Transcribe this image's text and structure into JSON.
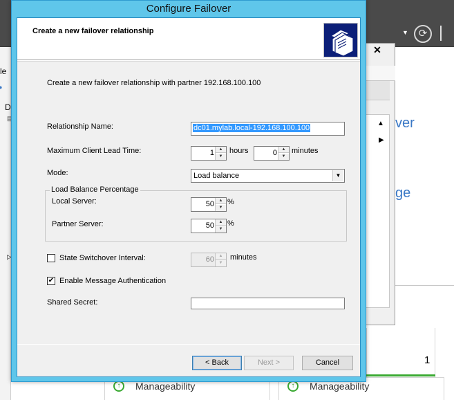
{
  "background": {
    "left_pane": [
      "le",
      "D"
    ],
    "links": [
      "ver",
      "ge"
    ],
    "card_value": "1",
    "status_items": [
      {
        "label": "Manageability"
      },
      {
        "label": "Manageability"
      }
    ]
  },
  "dialog": {
    "title": "Configure Failover",
    "header_title": "Create a new failover relationship",
    "description": "Create a new failover relationship with partner 192.168.100.100",
    "relationship_name": {
      "label": "Relationship Name:",
      "value": "dc01.mylab.local-192.168.100.100"
    },
    "mclt": {
      "label": "Maximum Client Lead Time:",
      "hours_value": "1",
      "hours_unit": "hours",
      "minutes_value": "0",
      "minutes_unit": "minutes"
    },
    "mode": {
      "label": "Mode:",
      "selected": "Load balance"
    },
    "load_balance": {
      "group_label": "Load Balance Percentage",
      "local_label": "Local Server:",
      "local_value": "50",
      "partner_label": "Partner Server:",
      "partner_value": "50",
      "unit": "%"
    },
    "state_switchover": {
      "label": "State Switchover Interval:",
      "checked": false,
      "value": "60",
      "unit": "minutes"
    },
    "message_auth": {
      "label": "Enable Message Authentication",
      "checked": true
    },
    "shared_secret": {
      "label": "Shared Secret:",
      "value": ""
    },
    "buttons": {
      "back": "< Back",
      "next": "Next >",
      "cancel": "Cancel"
    }
  },
  "colors": {
    "title_bar": "#5fc6ea",
    "selection": "#3399ff",
    "link": "#3a78c6",
    "status_green": "#3aa932"
  }
}
